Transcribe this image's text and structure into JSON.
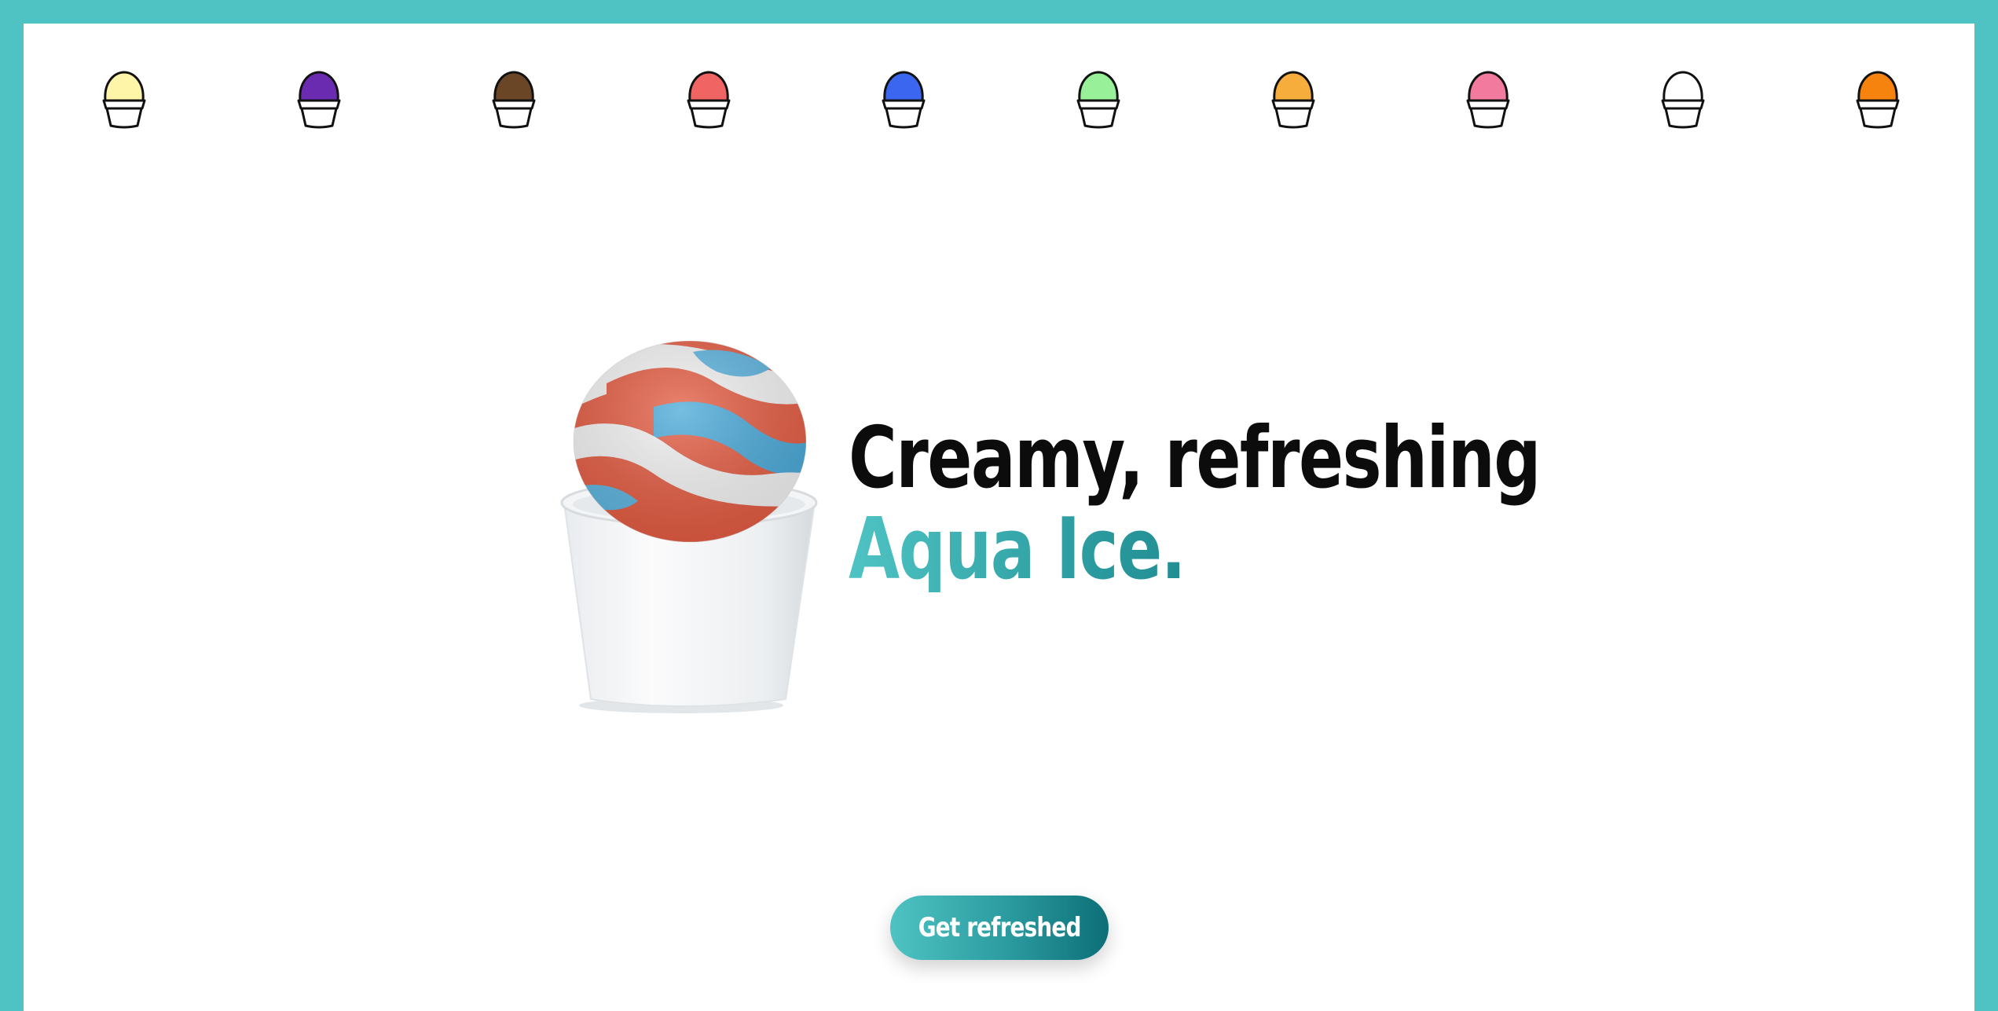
{
  "flavors": [
    {
      "name": "lemon-icon",
      "color": "#fff5a8"
    },
    {
      "name": "grape-icon",
      "color": "#6b2bb0"
    },
    {
      "name": "chocolate-icon",
      "color": "#6a4526"
    },
    {
      "name": "cherry-icon",
      "color": "#f06464"
    },
    {
      "name": "blue-raspberry-icon",
      "color": "#3b66f0"
    },
    {
      "name": "lime-icon",
      "color": "#98f098"
    },
    {
      "name": "mango-icon",
      "color": "#f7ad3c"
    },
    {
      "name": "strawberry-icon",
      "color": "#f17a9e"
    },
    {
      "name": "vanilla-icon",
      "color": "#ffffff"
    },
    {
      "name": "orange-icon",
      "color": "#f7830f"
    }
  ],
  "hero": {
    "headline_line1": "Creamy, refreshing",
    "headline_line2": "Aqua Ice.",
    "image_description_icon": "aqua-ice-cup-icon"
  },
  "cta": {
    "label": "Get refreshed"
  },
  "colors": {
    "border": "#4fc3c3",
    "accent_start": "#4fc3c3",
    "accent_end": "#0d6f78",
    "text_dark": "#0c0c0c"
  }
}
